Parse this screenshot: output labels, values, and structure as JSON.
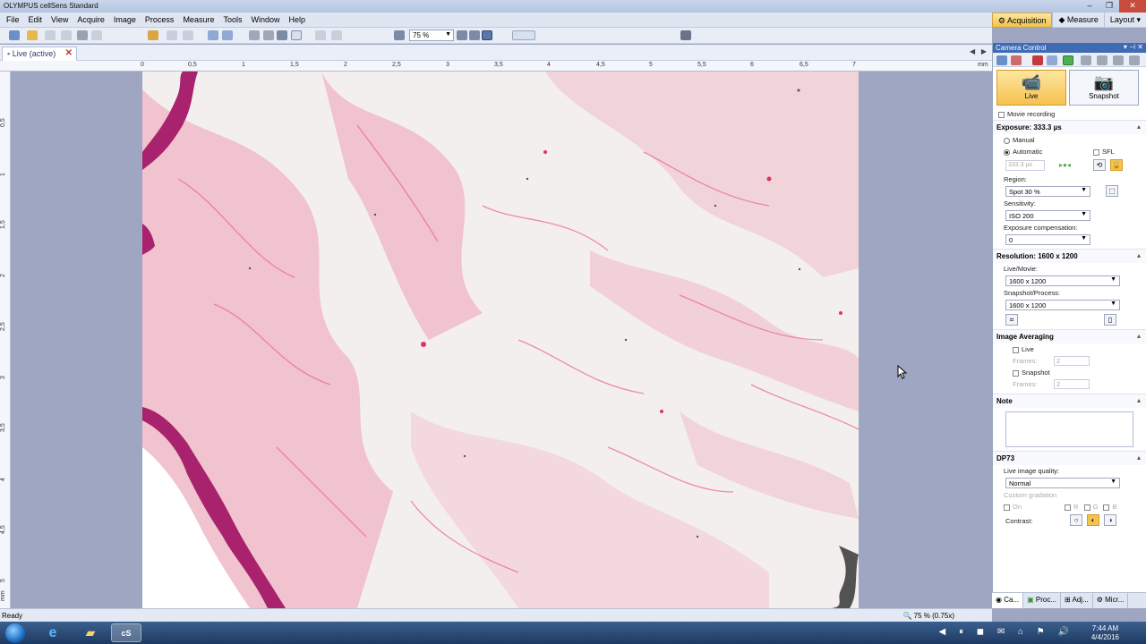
{
  "window": {
    "title": "OLYMPUS cellSens Standard"
  },
  "menubar": {
    "items": [
      "File",
      "Edit",
      "View",
      "Acquire",
      "Image",
      "Process",
      "Measure",
      "Tools",
      "Window",
      "Help"
    ]
  },
  "layout_tabs": [
    {
      "label": "Acquisition",
      "active": true
    },
    {
      "label": "Measure",
      "active": false
    },
    {
      "label": "Layout",
      "active": false
    }
  ],
  "toolbar": {
    "zoom_value": "75 %"
  },
  "document_tab": {
    "label": "Live (active)"
  },
  "ruler": {
    "h_ticks": [
      "0",
      "0,5",
      "1",
      "1,5",
      "2",
      "2,5",
      "3",
      "3,5",
      "4",
      "4,5",
      "5",
      "5,5",
      "6",
      "6,5",
      "7"
    ],
    "h_unit": "mm",
    "v_ticks": [
      "0,5",
      "1",
      "1,5",
      "2",
      "2,5",
      "3",
      "3,5",
      "4",
      "4,5",
      "5"
    ],
    "v_unit": "mm"
  },
  "status": {
    "text": "Ready",
    "zoom": "75 % (0.75x)"
  },
  "camera_control": {
    "title": "Camera Control",
    "live_label": "Live",
    "snapshot_label": "Snapshot",
    "movie_recording": "Movie recording",
    "exposure": {
      "header": "Exposure: 333.3 µs",
      "manual": "Manual",
      "automatic": "Automatic",
      "sfl": "SFL",
      "value": "333.3 µs",
      "region_label": "Region:",
      "region_value": "Spot 30 %",
      "sensitivity_label": "Sensitivity:",
      "sensitivity_value": "ISO 200",
      "comp_label": "Exposure compensation:",
      "comp_value": "0"
    },
    "resolution": {
      "header": "Resolution: 1600 x 1200",
      "live_label": "Live/Movie:",
      "live_value": "1600 x 1200",
      "snap_label": "Snapshot/Process:",
      "snap_value": "1600 x 1200"
    },
    "averaging": {
      "header": "Image Averaging",
      "live": "Live",
      "snapshot": "Snapshot",
      "frames_label": "Frames:",
      "frames_value": "2"
    },
    "note": {
      "header": "Note"
    },
    "dp73": {
      "header": "DP73",
      "quality_label": "Live image quality:",
      "quality_value": "Normal",
      "custom_label": "Custom gradation",
      "on_label": "On",
      "r": "R",
      "g": "G",
      "b": "B",
      "contrast_label": "Contrast:"
    }
  },
  "panel_tabs": [
    "Ca...",
    "Proc...",
    "Adj...",
    "Micr..."
  ],
  "taskbar": {
    "time": "7:44 AM",
    "date": "4/4/2016"
  }
}
